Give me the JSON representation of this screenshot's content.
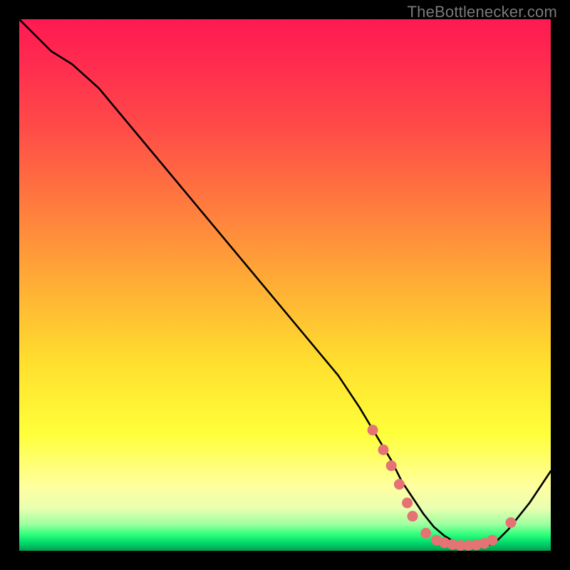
{
  "attribution_text": "TheBottlenecker.com",
  "colors": {
    "page_bg": "#000000",
    "curve": "#000000",
    "marker_fill": "#e57373",
    "marker_stroke": "#c94f4f"
  },
  "chart_data": {
    "type": "line",
    "title": "",
    "xlabel": "",
    "ylabel": "",
    "xlim": [
      0,
      100
    ],
    "ylim": [
      0,
      100
    ],
    "grid": false,
    "legend": false,
    "series": [
      {
        "name": "curve",
        "x": [
          0,
          3,
          6,
          10,
          15,
          20,
          25,
          30,
          35,
          40,
          45,
          50,
          55,
          60,
          64,
          67,
          70,
          72,
          74,
          76,
          78,
          80,
          82,
          84,
          86,
          88,
          89,
          90,
          92,
          94,
          96,
          98,
          100
        ],
        "y": [
          100,
          97,
          94,
          91.5,
          87,
          81,
          75,
          69,
          63,
          57,
          51,
          45,
          39,
          33,
          27,
          22,
          17,
          13,
          10,
          7,
          4.5,
          2.8,
          1.6,
          1.0,
          0.8,
          1.0,
          1.3,
          2.0,
          4.0,
          6.5,
          9.0,
          12,
          15
        ]
      }
    ],
    "markers": [
      {
        "x": 66.5,
        "y": 22.7
      },
      {
        "x": 68.5,
        "y": 19.0
      },
      {
        "x": 70.0,
        "y": 16.0
      },
      {
        "x": 71.5,
        "y": 12.5
      },
      {
        "x": 73.0,
        "y": 9.0
      },
      {
        "x": 74.0,
        "y": 6.5
      },
      {
        "x": 76.5,
        "y": 3.3
      },
      {
        "x": 78.5,
        "y": 2.0
      },
      {
        "x": 80.0,
        "y": 1.5
      },
      {
        "x": 81.5,
        "y": 1.2
      },
      {
        "x": 83.0,
        "y": 1.0
      },
      {
        "x": 84.5,
        "y": 1.0
      },
      {
        "x": 86.0,
        "y": 1.1
      },
      {
        "x": 87.5,
        "y": 1.4
      },
      {
        "x": 89.0,
        "y": 2.0
      },
      {
        "x": 92.5,
        "y": 5.3
      }
    ],
    "marker_radius": 7.5
  }
}
